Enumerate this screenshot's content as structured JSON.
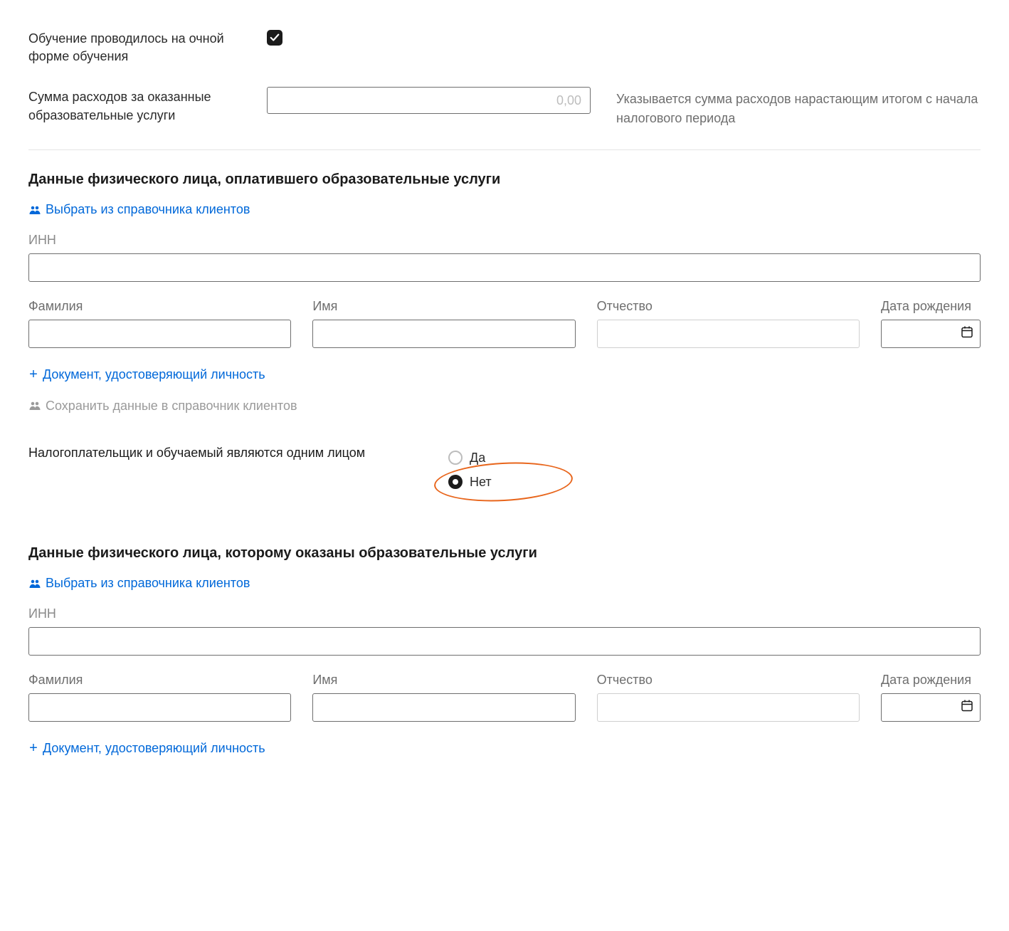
{
  "top": {
    "fullTimeLabel": "Обучение проводилось на очной форме обучения",
    "fullTimeChecked": true,
    "sumLabel": "Сумма расходов за оказанные образовательные услуги",
    "sumPlaceholder": "0,00",
    "sumHint": "Указывается сумма расходов нарастающим итогом с начала налогового периода"
  },
  "payer": {
    "title": "Данные физического лица, оплатившего образовательные услуги",
    "pickLink": "Выбрать из справочника клиентов",
    "innLabel": "ИНН",
    "lastNameLabel": "Фамилия",
    "firstNameLabel": "Имя",
    "middleNameLabel": "Отчество",
    "dobLabel": "Дата рождения",
    "addDocLink": "Документ, удостоверяющий личность",
    "saveLink": "Сохранить данные в справочник клиентов"
  },
  "samePerson": {
    "question": "Налогоплательщик и обучаемый являются одним лицом",
    "yes": "Да",
    "no": "Нет",
    "value": "no"
  },
  "student": {
    "title": "Данные физического лица, которому оказаны образовательные услуги",
    "pickLink": "Выбрать из справочника клиентов",
    "innLabel": "ИНН",
    "lastNameLabel": "Фамилия",
    "firstNameLabel": "Имя",
    "middleNameLabel": "Отчество",
    "dobLabel": "Дата рождения",
    "addDocLink": "Документ, удостоверяющий личность"
  }
}
